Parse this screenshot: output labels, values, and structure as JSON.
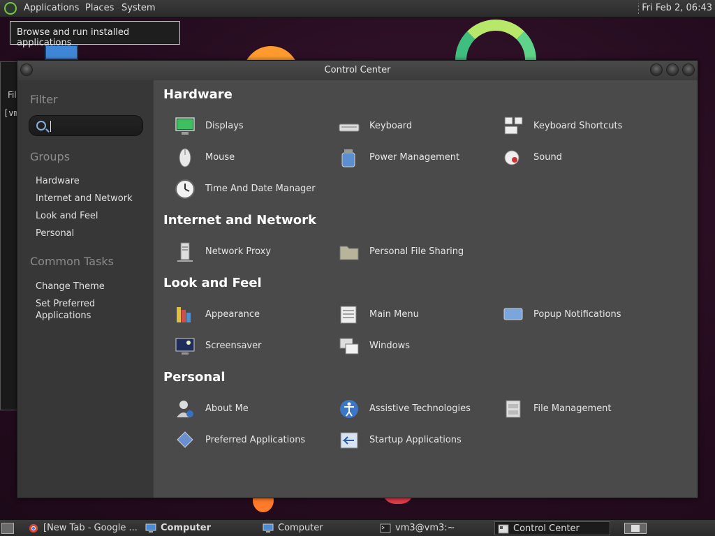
{
  "top_panel": {
    "menus": [
      "Applications",
      "Places",
      "System"
    ],
    "clock": "Fri Feb  2, 06:43"
  },
  "tooltip": "Browse and run installed applications",
  "bg_window": {
    "menu_fragment": "Fil",
    "terminal_fragment": "[vm"
  },
  "window": {
    "title": "Control Center"
  },
  "sidebar": {
    "filter_heading": "Filter",
    "search_placeholder": "",
    "groups_heading": "Groups",
    "groups": [
      "Hardware",
      "Internet and Network",
      "Look and Feel",
      "Personal"
    ],
    "tasks_heading": "Common Tasks",
    "tasks": [
      "Change Theme",
      "Set Preferred Applications"
    ]
  },
  "sections": [
    {
      "title": "Hardware",
      "items": [
        {
          "label": "Displays",
          "icon": "display-icon"
        },
        {
          "label": "Keyboard",
          "icon": "keyboard-icon"
        },
        {
          "label": "Keyboard Shortcuts",
          "icon": "keyboard-shortcuts-icon"
        },
        {
          "label": "Mouse",
          "icon": "mouse-icon"
        },
        {
          "label": "Power Management",
          "icon": "power-management-icon"
        },
        {
          "label": "Sound",
          "icon": "sound-icon"
        },
        {
          "label": "Time And Date Manager",
          "icon": "clock-icon"
        }
      ]
    },
    {
      "title": "Internet and Network",
      "items": [
        {
          "label": "Network Proxy",
          "icon": "network-proxy-icon"
        },
        {
          "label": "Personal File Sharing",
          "icon": "folder-share-icon"
        }
      ]
    },
    {
      "title": "Look and Feel",
      "items": [
        {
          "label": "Appearance",
          "icon": "appearance-icon"
        },
        {
          "label": "Main Menu",
          "icon": "main-menu-icon"
        },
        {
          "label": "Popup Notifications",
          "icon": "notification-icon"
        },
        {
          "label": "Screensaver",
          "icon": "screensaver-icon"
        },
        {
          "label": "Windows",
          "icon": "windows-icon"
        }
      ]
    },
    {
      "title": "Personal",
      "items": [
        {
          "label": "About Me",
          "icon": "about-me-icon"
        },
        {
          "label": "Assistive Technologies",
          "icon": "accessibility-icon"
        },
        {
          "label": "File Management",
          "icon": "file-management-icon"
        },
        {
          "label": "Preferred Applications",
          "icon": "preferred-apps-icon"
        },
        {
          "label": "Startup Applications",
          "icon": "startup-apps-icon"
        }
      ]
    }
  ],
  "taskbar": [
    {
      "label": "[New Tab - Google ...",
      "icon": "chrome-icon",
      "active": false
    },
    {
      "label": "Computer",
      "icon": "computer-icon",
      "active": false,
      "bold": true
    },
    {
      "label": "Computer",
      "icon": "computer-icon",
      "active": false
    },
    {
      "label": "vm3@vm3:~",
      "icon": "terminal-icon",
      "active": false
    },
    {
      "label": "Control Center",
      "icon": "control-center-icon",
      "active": true
    }
  ]
}
